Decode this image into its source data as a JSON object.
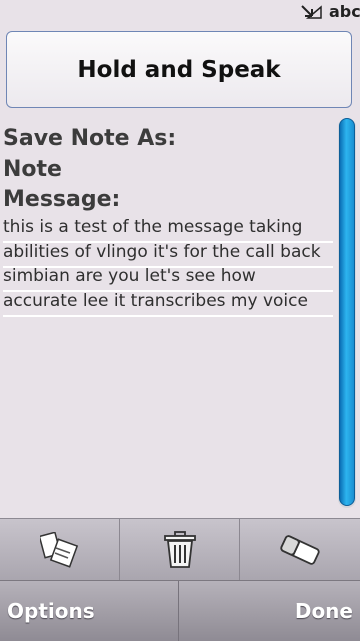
{
  "status_bar": {
    "input_mode": "abc",
    "icon": "signal-icon"
  },
  "speak_button": {
    "label": "Hold and Speak"
  },
  "note": {
    "save_as_label": "Save Note As:",
    "type_label": "Note",
    "message_label": "Message:",
    "message_lines": [
      "this is a test of the message taking",
      "abilities of vlingo it's for the call back",
      "simbian are you let's see how",
      "accurate lee it transcribes my voice"
    ]
  },
  "toolbar": {
    "buttons": [
      {
        "icon": "clipboard-icon"
      },
      {
        "icon": "trash-icon"
      },
      {
        "icon": "eraser-icon"
      }
    ]
  },
  "softkeys": {
    "left": "Options",
    "right": "Done"
  }
}
